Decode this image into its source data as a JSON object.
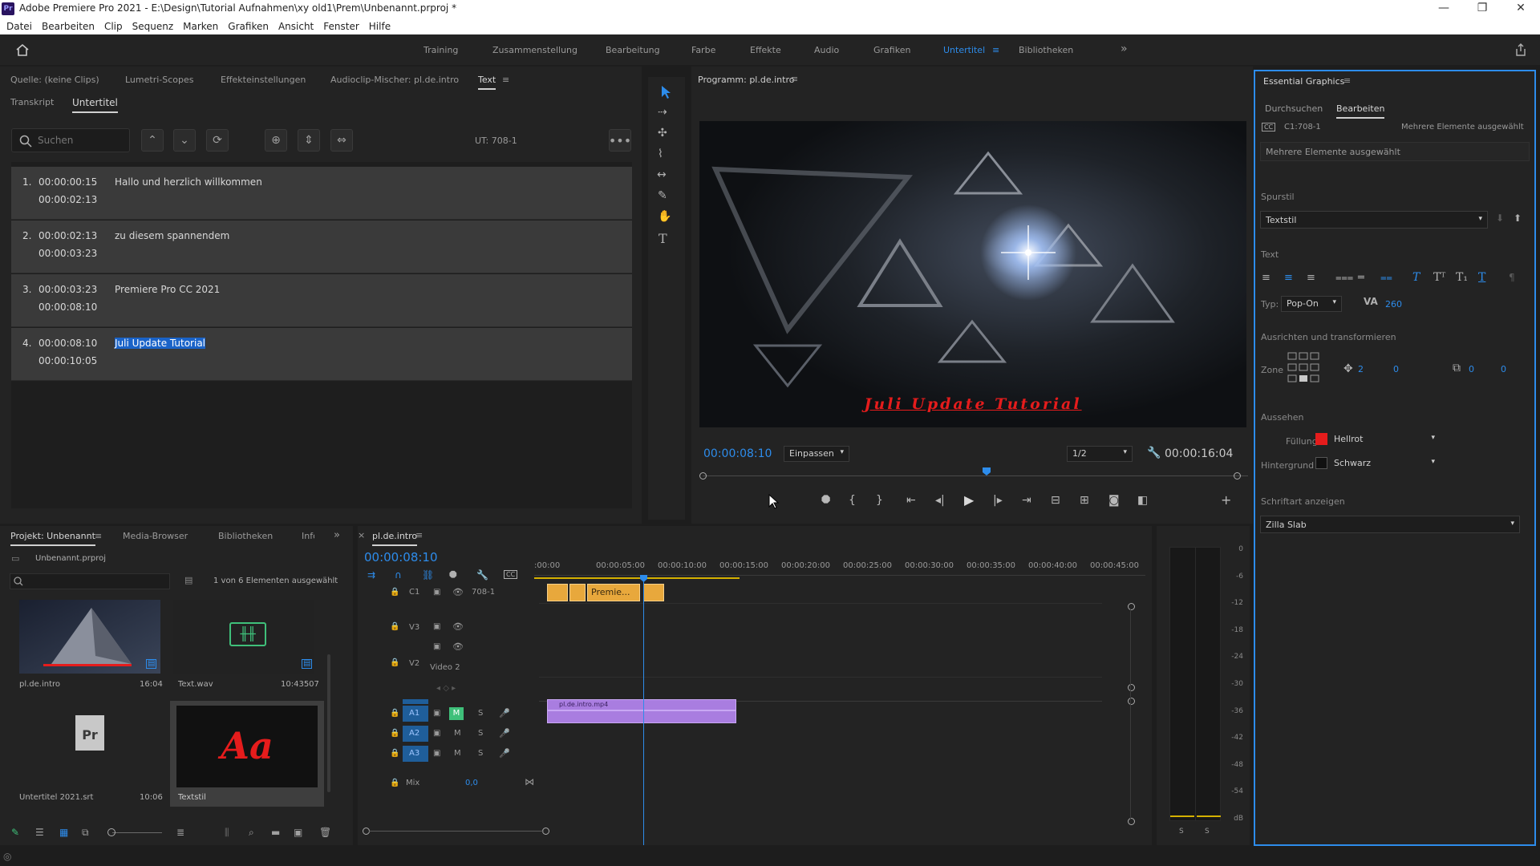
{
  "app": {
    "logo": "Pr",
    "title": "Adobe Premiere Pro 2021 - E:\\Design\\Tutorial Aufnahmen\\xy old1\\Prem\\Unbenannt.prproj *",
    "window_controls": [
      "—",
      "❐",
      "✕"
    ]
  },
  "menu": [
    "Datei",
    "Bearbeiten",
    "Clip",
    "Sequenz",
    "Marken",
    "Grafiken",
    "Ansicht",
    "Fenster",
    "Hilfe"
  ],
  "workspaces": [
    "Training",
    "Zusammenstellung",
    "Bearbeitung",
    "Farbe",
    "Effekte",
    "Audio",
    "Grafiken",
    "Untertitel",
    "Bibliotheken"
  ],
  "workspace_active": "Untertitel",
  "source_panel": {
    "tabs": [
      "Quelle: (keine Clips)",
      "Lumetri-Scopes",
      "Effekteinstellungen",
      "Audioclip-Mischer: pl.de.intro",
      "Text"
    ],
    "subtabs": [
      "Transkript",
      "Untertitel"
    ],
    "search_placeholder": "Suchen",
    "track_label": "UT: 708-1",
    "captions": [
      {
        "n": "1.",
        "start": "00:00:00:15",
        "end": "00:00:02:13",
        "text": "Hallo und herzlich willkommen"
      },
      {
        "n": "2.",
        "start": "00:00:02:13",
        "end": "00:00:03:23",
        "text": "zu diesem spannendem"
      },
      {
        "n": "3.",
        "start": "00:00:03:23",
        "end": "00:00:08:10",
        "text": "Premiere Pro CC 2021"
      },
      {
        "n": "4.",
        "start": "00:00:08:10",
        "end": "00:00:10:05",
        "text": "Juli Update Tutorial"
      }
    ]
  },
  "program": {
    "title": "Programm: pl.de.intro",
    "caption_overlay": "Juli Update Tutorial",
    "timecode": "00:00:08:10",
    "fit": "Einpassen",
    "resolution": "1/2",
    "duration": "00:00:16:04",
    "playhead_fraction": 0.52
  },
  "essential_graphics": {
    "title": "Essential Graphics",
    "tabs": [
      "Durchsuchen",
      "Bearbeiten"
    ],
    "caption_id": "C1:708-1",
    "multi_note": "Mehrere Elemente ausgewählt",
    "multi_field": "Mehrere Elemente ausgewählt",
    "spurstil_label": "Spurstil",
    "spurstil_value": "Textstil",
    "text_label": "Text",
    "typ_label": "Typ:",
    "typ_value": "Pop-On",
    "tracking_value": "260",
    "align_label": "Ausrichten und transformieren",
    "zone_label": "Zone",
    "pos_x": "2",
    "pos_y": "0",
    "scale_a": "0",
    "scale_b": "0",
    "look_label": "Aussehen",
    "fill_label": "Füllung",
    "fill_value": "Hellrot",
    "fill_color": "#e51c1c",
    "bg_label": "Hintergrund",
    "bg_value": "Schwarz",
    "font_label": "Schriftart anzeigen",
    "font_value": "Zilla Slab"
  },
  "project": {
    "tabs": [
      "Projekt: Unbenannt",
      "Media-Browser",
      "Bibliotheken",
      "Info"
    ],
    "file": "Unbenannt.prproj",
    "selection": "1 von 6 Elementen ausgewählt",
    "items": [
      {
        "name": "pl.de.intro",
        "duration": "16:04"
      },
      {
        "name": "Text.wav",
        "duration": "10:43507"
      },
      {
        "name": "Untertitel 2021.srt",
        "duration": "10:06"
      },
      {
        "name": "Textstil",
        "duration": "",
        "thumb_text": "Aa"
      }
    ]
  },
  "timeline": {
    "tab": "pl.de.intro",
    "timecode": "00:00:08:10",
    "ruler": [
      ":00:00",
      "00:00:05:00",
      "00:00:10:00",
      "00:00:15:00",
      "00:00:20:00",
      "00:00:25:00",
      "00:00:30:00",
      "00:00:35:00",
      "00:00:40:00",
      "00:00:45:00"
    ],
    "caption_track": {
      "id": "C1",
      "name": "708-1"
    },
    "caption_clip_label": "Premie...",
    "video_tracks": [
      "V3",
      "V2"
    ],
    "video2_name": "Video 2",
    "audio_tracks": [
      "A1",
      "A2",
      "A3"
    ],
    "clip_label": "pl.de.intro.mp4",
    "mix_label": "Mix",
    "mix_value": "0,0",
    "m_label": "M",
    "s_label": "S"
  },
  "meter": {
    "ticks": [
      "0",
      "-6",
      "-12",
      "-18",
      "-24",
      "-30",
      "-36",
      "-42",
      "-48",
      "-54",
      "dB"
    ],
    "solo": [
      "S",
      "S"
    ]
  },
  "icons": [
    "home-icon",
    "search-icon",
    "share-icon",
    "selection-tool-icon",
    "play-icon",
    "wrench-icon",
    "lock-icon",
    "eye-icon",
    "mic-icon",
    "pencil-icon"
  ]
}
